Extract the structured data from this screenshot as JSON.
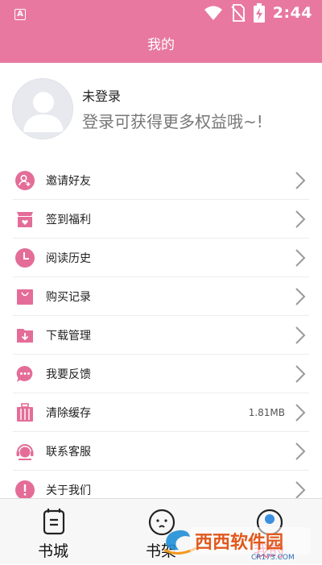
{
  "status_bar": {
    "app_badge": "A",
    "time": "2:44"
  },
  "header": {
    "title": "我的"
  },
  "profile": {
    "name": "未登录",
    "subtitle": "登录可获得更多权益哦~!"
  },
  "menu": {
    "items": [
      {
        "label": "邀请好友",
        "icon": "invite-friend-icon"
      },
      {
        "label": "签到福利",
        "icon": "sign-in-gift-icon"
      },
      {
        "label": "阅读历史",
        "icon": "clock-icon"
      },
      {
        "label": "购买记录",
        "icon": "shopping-bag-icon"
      },
      {
        "label": "下载管理",
        "icon": "download-folder-icon"
      },
      {
        "label": "我要反馈",
        "icon": "feedback-chat-icon"
      },
      {
        "label": "清除缓存",
        "icon": "luggage-icon",
        "meta": "1.81MB"
      },
      {
        "label": "联系客服",
        "icon": "headset-icon"
      },
      {
        "label": "关于我们",
        "icon": "info-icon"
      }
    ]
  },
  "tabs": [
    {
      "label": "书城",
      "icon": "bookstore-icon"
    },
    {
      "label": "书架",
      "icon": "bookshelf-icon"
    },
    {
      "label": "我的",
      "icon": "profile-icon"
    }
  ],
  "watermark": {
    "text": "西西软件园",
    "sub": "CR173.COM"
  },
  "colors": {
    "accent": "#e8789f",
    "icon_pink": "#e46d98"
  }
}
